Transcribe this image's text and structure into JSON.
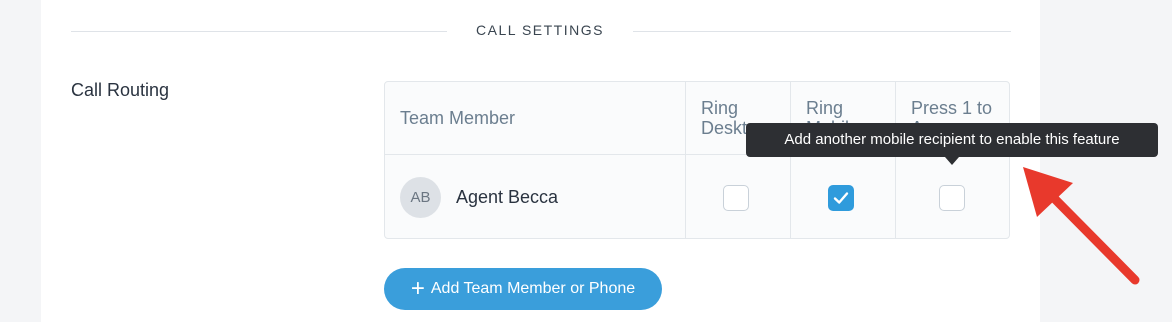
{
  "section": {
    "title": "CALL SETTINGS"
  },
  "call_routing": {
    "label": "Call Routing",
    "columns": [
      "Team Member",
      "Ring Desktop",
      "Ring Mobile",
      "Press 1 to Answer"
    ],
    "rows": [
      {
        "initials": "AB",
        "name": "Agent Becca",
        "ring_desktop": false,
        "ring_mobile": true,
        "press_1_to_answer": false
      }
    ]
  },
  "tooltip": {
    "text": "Add another mobile recipient to enable this feature"
  },
  "add_button": {
    "icon": "+",
    "label": "Add Team Member or Phone"
  },
  "colors": {
    "accent": "#3a9edb",
    "annotation_arrow": "#e8392c"
  }
}
